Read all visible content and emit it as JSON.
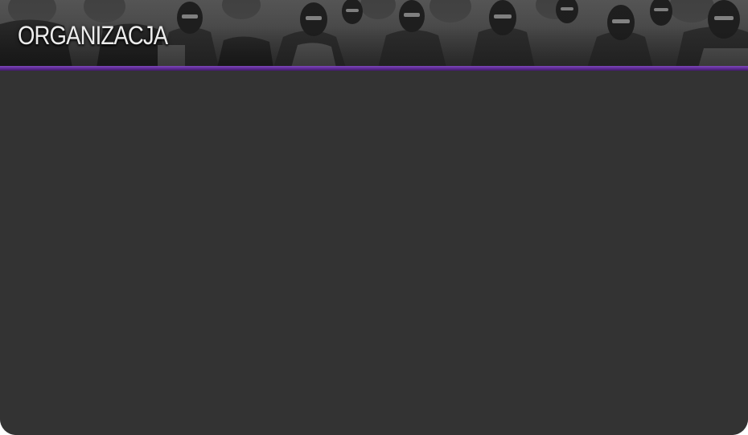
{
  "header": {
    "title": "ORGANIZACJA",
    "banner_image": "crowd-of-masked-people-photo"
  },
  "colors": {
    "accent": "#5d2a94",
    "content_background": "#333333",
    "title_text": "#ececec"
  }
}
